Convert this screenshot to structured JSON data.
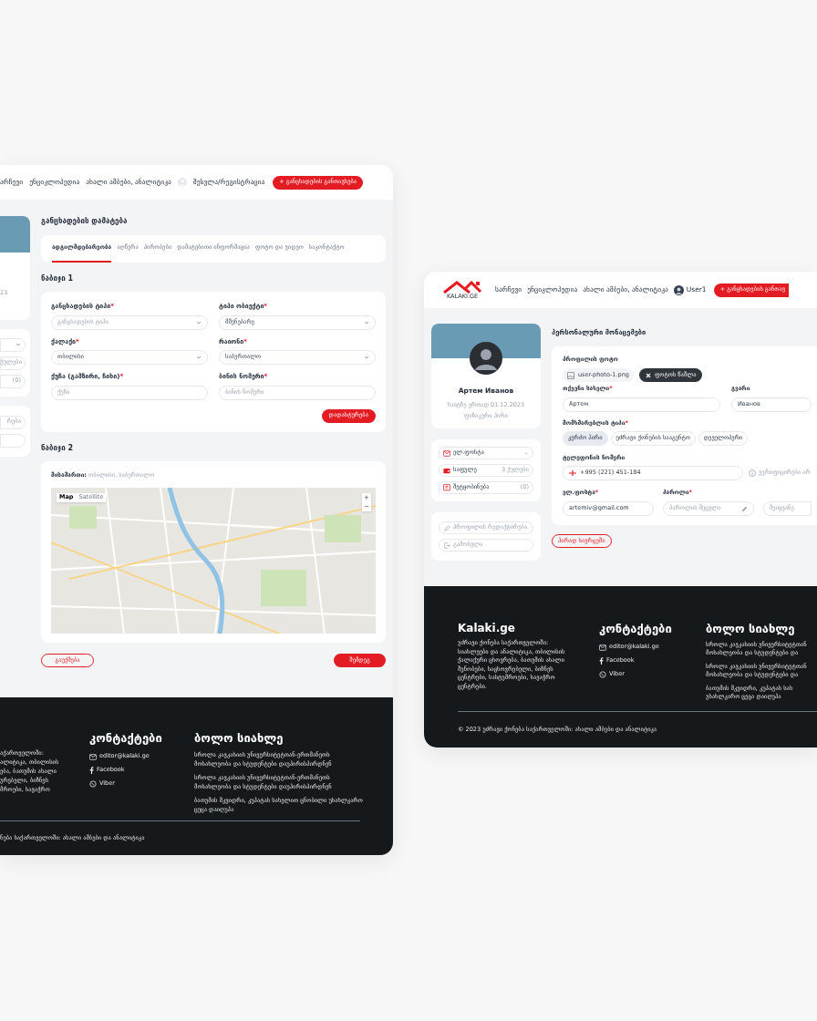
{
  "left_screen": {
    "nav": [
      "არჩევი",
      "ენციკლოპედია",
      "ახალი ამბები, ანალიტიკა"
    ],
    "login_link": "შესვლა/რეგისტრაცია",
    "post_button": "+ განცხადების განთავსება",
    "sidebar_fragments": {
      "date": "23",
      "points": "ქულები",
      "messages": "(0)",
      "edit": "რება"
    },
    "page_title": "განცხადების დამატება",
    "tabs": [
      {
        "label": "ადგილმდებარეობა",
        "selected": true
      },
      {
        "label": "აღწერა",
        "selected": false
      },
      {
        "label": "პირობები",
        "selected": false
      },
      {
        "label": "დამატებითი ინფორმაცია",
        "selected": false
      },
      {
        "label": "ფოტო და ვიდეო",
        "selected": false
      },
      {
        "label": "საკონტაქტო",
        "selected": false
      }
    ],
    "step1_title": "ნაბიჯი 1",
    "fields": [
      {
        "label": "განცხადების ტიპი",
        "mark": "*",
        "kind": "select",
        "placeholder": "განცხადების ტიპი"
      },
      {
        "label": "ტიპი ობიექტი",
        "mark": "*",
        "kind": "select",
        "value": "მშენებარე"
      },
      {
        "label": "ქალაქი",
        "mark": "*",
        "kind": "select",
        "value": "თბილისი"
      },
      {
        "label": "რაიონი",
        "mark": "*",
        "kind": "select",
        "value": "საბურთალო"
      },
      {
        "label": "ქუჩა (გამზირი, ჩიხი)",
        "mark": "*",
        "kind": "input",
        "placeholder": "ქუჩა"
      },
      {
        "label": "ბინის ნომერი",
        "mark": "*",
        "kind": "input",
        "placeholder": "ბინის ნომერი"
      }
    ],
    "confirm_button": "დადასტურება",
    "step2_title": "ნაბიჯი 2",
    "address": "**მისამართი:** თბილისი, საბურთალო",
    "map": {
      "modes": [
        {
          "label": "Map",
          "selected": true
        },
        {
          "label": "Satellite",
          "selected": false
        }
      ],
      "zoom_in": "+",
      "zoom_out": "−"
    },
    "cancel_button": "გაუქმება",
    "next_button": "შემდეგ",
    "footer": {
      "about_lines": [
        "აქართველოში:",
        "ალიტიკა, თბილისის",
        "ება, ბათუმის ახალი",
        "ურებელი, ბიზნეს",
        "მროები, სავაჭრო"
      ],
      "contacts_title": "კონტაქტები",
      "contacts": [
        {
          "kind": "email",
          "label": "editor@kalaki.ge"
        },
        {
          "kind": "facebook",
          "label": "Facebook"
        },
        {
          "kind": "viber",
          "label": "Viber"
        }
      ],
      "news_title": "ბოლო სიახლე",
      "news": [
        "სროლა კავკასიის უნივერსიტეტთან-ერთმანეთს მოსახლეობა და სტუდენტები დაუპირისპირდნენ",
        "სროლა კავკასიის უნივერსიტეტთან-ერთმანეთს მოსახლეობა და სტუდენტები დაუპირისპირდნენ",
        "ბათუმის მკვიდრი, კუპატას სახელით ცნობილი უსახლკარო ცეცა დაიღუპა"
      ],
      "copyright": "ნება საქართველოში: ახალი ამბები და ანალიტიკა"
    }
  },
  "right_screen": {
    "logo": "KALAKI.GE",
    "nav": [
      "სარჩევი",
      "ენციკლოპედია",
      "ახალი ამბები, ანალიტიკა"
    ],
    "user_name": "User1",
    "post_button": "+ განცხადების განთავ",
    "profile": {
      "name": "Артем Иванов",
      "since": "საიტზე ერთად 01.12.2023",
      "type": "ფიზიკური პირი"
    },
    "menu": [
      {
        "kind": "email",
        "label": "ელ.ფოსტა",
        "extra": "⌄"
      },
      {
        "kind": "wallet",
        "label": "საფულე",
        "extra": "3 ქულები"
      },
      {
        "kind": "message",
        "label": "შეტყობინება",
        "extra": "(0)"
      }
    ],
    "actions": [
      {
        "kind": "edit",
        "label": "პროფილის რედაქტირება"
      },
      {
        "kind": "logout",
        "label": "გამოსვლა"
      }
    ],
    "page_title": "პერსონალური მონაცემები",
    "photo_label": "პროფილის ფოტო",
    "photo_file": "user-photo-1.png",
    "delete_photo_button": "ფოტოს წაშლა",
    "first_name": {
      "label": "თქვენი სახელი",
      "mark": "*",
      "value": "Артем"
    },
    "last_name": {
      "label": "გვარი",
      "value": "Иванов"
    },
    "user_type": {
      "label": "მომხმარებლის ტიპი",
      "mark": "*",
      "options": [
        {
          "label": "კერძო პირი",
          "selected": true
        },
        {
          "label": "უძრავი ქონების სააგენტო",
          "selected": false
        },
        {
          "label": "დეველოპერი",
          "selected": false
        }
      ]
    },
    "phone": {
      "label": "ტელეფონის ნომერი",
      "value": "+995 (221) 451-184",
      "note": "ვერიფიცირება არ"
    },
    "email": {
      "label": "ელ.ფოსტა",
      "mark": "*",
      "value": "artemiv@gmail.com"
    },
    "password": {
      "label": "პაროლი",
      "mark": "*",
      "placeholder": "პაროლის შეცვლა",
      "repeat_placeholder": "შეიყვანე"
    },
    "private_button": "პირად სივრცეში",
    "footer": {
      "brand": "Kalaki.ge",
      "about": "უძრავი ქონება საქართველოში: სიახლეები და ანალიტიკა, თბილისის ქალაქური ცხოვრება, ბათუმის ახალი შენობები, საცხოვრებელი, ბიზნეს ცენტრები, სასტუმროები, სავაჭრო ცენტრები.",
      "contacts_title": "კონტაქტები",
      "contacts": [
        {
          "kind": "email",
          "label": "editor@kalaki.ge"
        },
        {
          "kind": "facebook",
          "label": "Facebook"
        },
        {
          "kind": "viber",
          "label": "Viber"
        }
      ],
      "news_title": "ბოლო სიახლე",
      "news_lines": [
        [
          "სროლა კავკასიის უნივერსიტეტთან",
          "მოსახლეობა და სტუდენტები და"
        ],
        [
          "სროლა კავკასიის უნივერსიტეტთან",
          "მოსახლეობა და სტუდენტები და"
        ],
        [
          "ბათუმის მკვიდრი, კუპატას სახ",
          "უსახლკარო ცეცა დაიღუპა"
        ]
      ],
      "copyright": "© 2023 უძრავი ქონება საქართველოში: ახალი ამბები და ანალიტიკა"
    }
  }
}
